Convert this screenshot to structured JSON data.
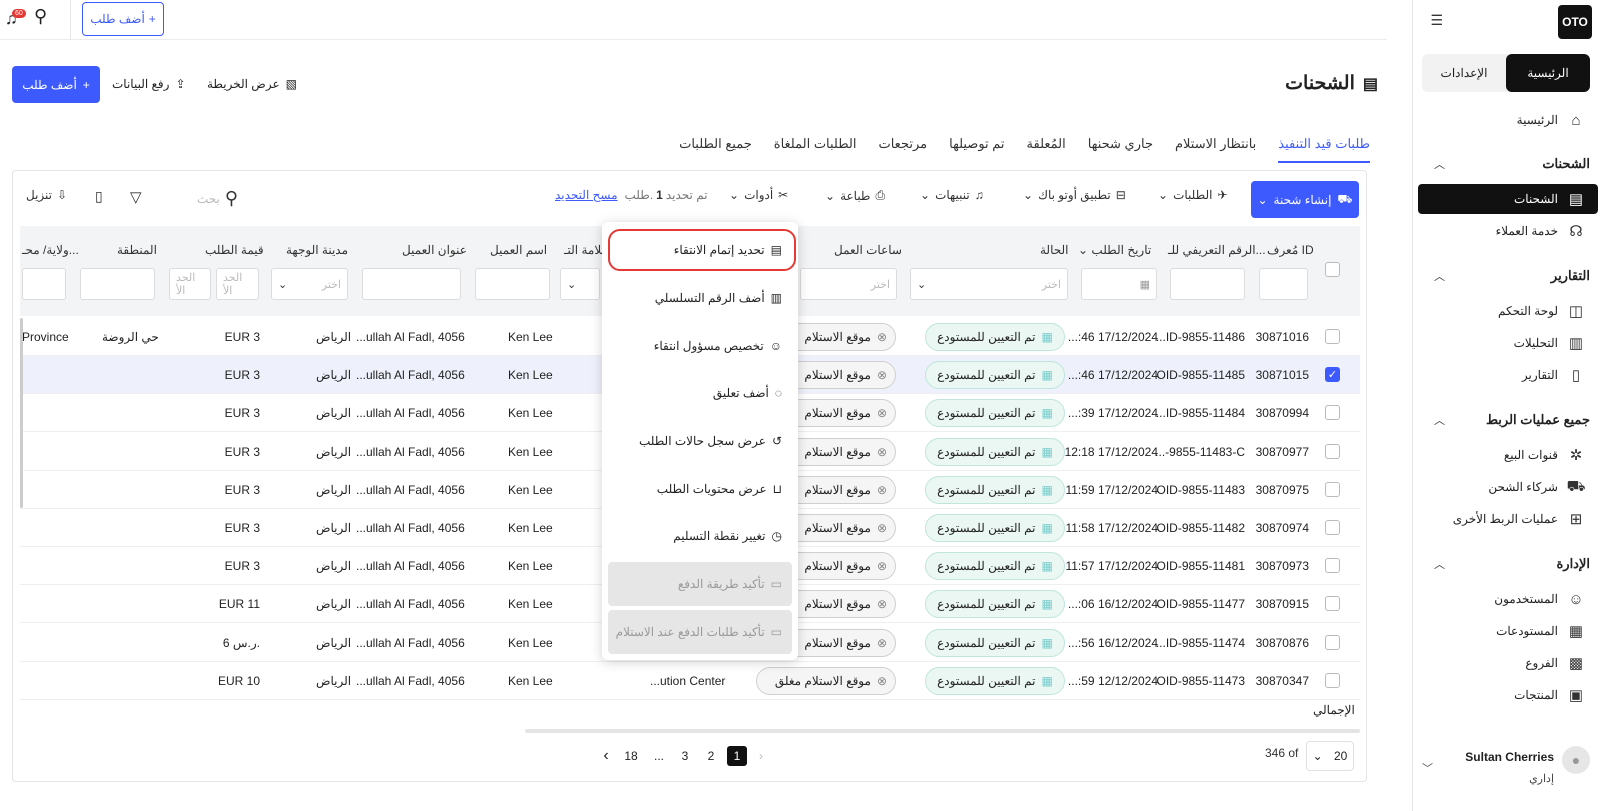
{
  "sidebar": {
    "logo": "OTO",
    "tabs": [
      "الرئيسية",
      "الإعدادات"
    ],
    "home": "الرئيسية",
    "sections": [
      {
        "title": "الشحنات",
        "items": [
          "الشحنات",
          "خدمة العملاء"
        ]
      },
      {
        "title": "التقارير",
        "items": [
          "لوحة التحكم",
          "التحليلات",
          "التقارير"
        ]
      },
      {
        "title": "جميع عمليات الربط",
        "items": [
          "قنوات البيع",
          "شركاء الشحن",
          "عمليات الربط الأخرى"
        ]
      },
      {
        "title": "الإدارة",
        "items": [
          "المستخدمون",
          "المستودعات",
          "الفروع",
          "المنتجات"
        ]
      }
    ],
    "user": {
      "name": "Sultan Cherries",
      "role": "إداري"
    }
  },
  "topbar": {
    "add_order": "أضف طلب",
    "notif_count": "60"
  },
  "header": {
    "title": "الشحنات",
    "view_map": "عرض الخريطة",
    "upload_data": "رفع البيانات",
    "add_order": "أضف طلب"
  },
  "tabs": [
    "طلبات قيد التنفيذ",
    "بانتظار الاستلام",
    "جاري شحنها",
    "المُعلقة",
    "تم توصيلها",
    "مرتجعات",
    "الطلبات الملغاة",
    "جميع الطلبات"
  ],
  "toolbar": {
    "create_shipment": "إنشاء شحنة",
    "orders": "الطلبات",
    "autopack": "تطبيق أوتو باك",
    "alerts": "تنبيهات",
    "print": "طباعة",
    "tools": "أدوات",
    "selected_prefix": "تم تحديد",
    "selected_count": "1",
    "selected_suffix": "طلب.",
    "clear_selection": "مسح التحديد",
    "search_placeholder": "بحث",
    "download": "تنزيل"
  },
  "columns": {
    "id": "مُعرف ID",
    "ref": "الرقم التعريفي للـ...",
    "date": "تاريخ الطلب",
    "status": "الحالة",
    "hours": "ساعات العمل",
    "brand": "علامة التـ...",
    "customer": "اسم العميل",
    "address": "عنوان العميل",
    "city": "مدينة الوجهة",
    "value": "قيمة الطلب",
    "region": "المنطقة",
    "province": "ولاية/ محـ..."
  },
  "filters": {
    "choose": "اختر",
    "min": "الحد الأ",
    "max": "الحد الأ"
  },
  "rows": [
    {
      "id": "30871016",
      "ref": "...ID-9855-11486",
      "date": "...:46 17/12/2024",
      "status": "تم التعيين للمستودع",
      "pickup": "موقع الاستلام",
      "customer": "Ken Lee",
      "address": "...ullah Al Fadl, 4056",
      "city": "الرياض",
      "value": "EUR 3",
      "region": "حي الروضة",
      "province": "Province",
      "selected": false
    },
    {
      "id": "30871015",
      "ref": "OID-9855-11485",
      "date": "...:46 17/12/2024",
      "status": "تم التعيين للمستودع",
      "pickup": "موقع الاستلام",
      "customer": "Ken Lee",
      "address": "...ullah Al Fadl, 4056",
      "city": "الرياض",
      "value": "EUR 3",
      "region": "",
      "province": "",
      "selected": true
    },
    {
      "id": "30870994",
      "ref": "...ID-9855-11484",
      "date": "...:39 17/12/2024",
      "status": "تم التعيين للمستودع",
      "pickup": "موقع الاستلام",
      "customer": "Ken Lee",
      "address": "...ullah Al Fadl, 4056",
      "city": "الرياض",
      "value": "EUR 3",
      "region": "",
      "province": "",
      "selected": false
    },
    {
      "id": "30870977",
      "ref": "...-9855-11483-C",
      "date": "12:18 17/12/2024",
      "status": "تم التعيين للمستودع",
      "pickup": "موقع الاستلام",
      "customer": "Ken Lee",
      "address": "...ullah Al Fadl, 4056",
      "city": "الرياض",
      "value": "EUR 3",
      "region": "",
      "province": "",
      "selected": false
    },
    {
      "id": "30870975",
      "ref": "OID-9855-11483",
      "date": "11:59 17/12/2024",
      "status": "تم التعيين للمستودع",
      "pickup": "موقع الاستلام",
      "customer": "Ken Lee",
      "address": "...ullah Al Fadl, 4056",
      "city": "الرياض",
      "value": "EUR 3",
      "region": "",
      "province": "",
      "selected": false
    },
    {
      "id": "30870974",
      "ref": "OID-9855-11482",
      "date": "11:58 17/12/2024",
      "status": "تم التعيين للمستودع",
      "pickup": "موقع الاستلام",
      "customer": "Ken Lee",
      "address": "...ullah Al Fadl, 4056",
      "city": "الرياض",
      "value": "EUR 3",
      "region": "",
      "province": "",
      "selected": false
    },
    {
      "id": "30870973",
      "ref": "OID-9855-11481",
      "date": "11:57 17/12/2024",
      "status": "تم التعيين للمستودع",
      "pickup": "موقع الاستلام",
      "customer": "Ken Lee",
      "address": "...ullah Al Fadl, 4056",
      "city": "الرياض",
      "value": "EUR 3",
      "region": "",
      "province": "",
      "selected": false
    },
    {
      "id": "30870915",
      "ref": "OID-9855-11477",
      "date": "...:06 16/12/2024",
      "status": "تم التعيين للمستودع",
      "pickup": "موقع الاستلام",
      "customer": "Ken Lee",
      "address": "...ullah Al Fadl, 4056",
      "city": "الرياض",
      "value": "EUR 11",
      "region": "",
      "province": "",
      "selected": false
    },
    {
      "id": "30870876",
      "ref": "...ID-9855-11474",
      "date": "...:56 16/12/2024",
      "status": "تم التعيين للمستودع",
      "pickup": "موقع الاستلام",
      "customer": "Ken Lee",
      "address": "...ullah Al Fadl, 4056",
      "city": "الرياض",
      "value": "6 ر.س.",
      "region": "",
      "province": "",
      "selected": false
    },
    {
      "id": "30870347",
      "ref": "OID-9855-11473",
      "date": "...:59 12/12/2024",
      "status": "تم التعيين للمستودع",
      "pickup": "موقع الاستلام مغلق",
      "customer": "Ken Lee",
      "address": "...ullah Al Fadl, 4056",
      "city": "الرياض",
      "value": "EUR 10",
      "region": "",
      "province": "",
      "selected": false,
      "brand_text": "...ution Center"
    }
  ],
  "total_label": "الإجمالي",
  "pagination": {
    "per_page": "20",
    "total": "346 of",
    "pages": [
      "1",
      "2",
      "3",
      "...",
      "18"
    ]
  },
  "menu": {
    "items": [
      "تحديد إتمام الانتقاء",
      "أضف الرقم التسلسلي",
      "تخصيص مسؤول انتقاء",
      "أضف تعليق",
      "عرض سجل حالات الطلب",
      "عرض محتويات الطلب",
      "تغيير نقطة التسليم"
    ],
    "disabled": [
      "تأكيد طريقة الدفع",
      "تأكيد طلبات الدفع عند الاستلام"
    ]
  },
  "colors": {
    "accent": "#3d5afe",
    "highlight": "#e53935",
    "status_bg": "#eaf7f3"
  }
}
